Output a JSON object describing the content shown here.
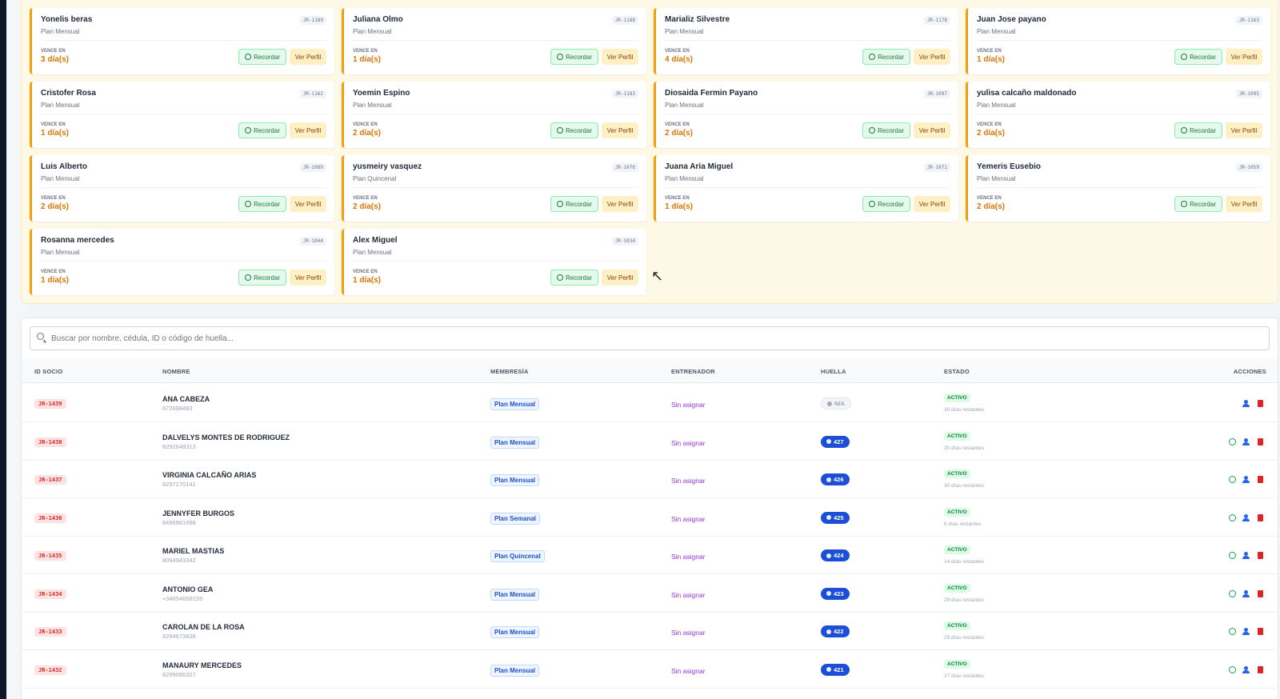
{
  "alerts": {
    "vence_label": "VENCE EN",
    "recordar_label": "Recordar",
    "perfil_label": "Ver Perfil",
    "cards": [
      {
        "name": "Yonelis beras",
        "plan": "Plan Mensual",
        "code": "JR-1189",
        "days": "3 día(s)"
      },
      {
        "name": "Juliana Olmo",
        "plan": "Plan Mensual",
        "code": "JR-1188",
        "days": "1 día(s)"
      },
      {
        "name": "Marializ Silvestre",
        "plan": "Plan Mensual",
        "code": "JR-1178",
        "days": "4 día(s)"
      },
      {
        "name": "Juan Jose payano",
        "plan": "Plan Mensual",
        "code": "JR-1163",
        "days": "1 día(s)"
      },
      {
        "name": "Cristofer Rosa",
        "plan": "Plan Mensual",
        "code": "JR-1162",
        "days": "1 día(s)"
      },
      {
        "name": "Yoemin Espino",
        "plan": "Plan Mensual",
        "code": "JR-1183",
        "days": "2 día(s)"
      },
      {
        "name": "Diosaida Fermin Payano",
        "plan": "Plan Mensual",
        "code": "JR-1097",
        "days": "2 día(s)"
      },
      {
        "name": "yulisa calcaño maldonado",
        "plan": "Plan Mensual",
        "code": "JR-1095",
        "days": "2 día(s)"
      },
      {
        "name": "Luis Alberto",
        "plan": "Plan Mensual",
        "code": "JR-1089",
        "days": "2 día(s)"
      },
      {
        "name": "yusmeiry vasquez",
        "plan": "Plan Quincenal",
        "code": "JR-1076",
        "days": "2 día(s)"
      },
      {
        "name": "Juana Aria Miguel",
        "plan": "Plan Mensual",
        "code": "JR-1071",
        "days": "1 día(s)"
      },
      {
        "name": "Yemeris Eusebio",
        "plan": "Plan Mensual",
        "code": "JR-1059",
        "days": "2 día(s)"
      },
      {
        "name": "Rosanna mercedes",
        "plan": "Plan Mensual",
        "code": "JR-1044",
        "days": "1 día(s)"
      },
      {
        "name": "Alex Miguel",
        "plan": "Plan Mensual",
        "code": "JR-1034",
        "days": "1 día(s)"
      }
    ]
  },
  "search": {
    "placeholder": "Buscar por nombre, cédula, ID o código de huella..."
  },
  "table": {
    "headers": {
      "id": "ID SOCIO",
      "nombre": "NOMBRE",
      "membresia": "MEMBRESÍA",
      "entrenador": "ENTRENADOR",
      "huella": "HUELLA",
      "estado": "ESTADO",
      "acciones": "ACCIONES"
    },
    "rows": [
      {
        "id": "JR-1439",
        "name": "ANA CABEZA",
        "phone": "672698483",
        "plan": "Plan Mensual",
        "trainer": "Sin asignar",
        "huella": "N/A",
        "status": "ACTIVO",
        "remaining": "30 días restantes"
      },
      {
        "id": "JR-1438",
        "name": "DALVELYS MONTES DE RODRIGUEZ",
        "phone": "8292648313",
        "plan": "Plan Mensual",
        "trainer": "Sin asignar",
        "huella": "427",
        "status": "ACTIVO",
        "remaining": "30 días restantes"
      },
      {
        "id": "JR-1437",
        "name": "VIRGINIA CALCAÑO ARIAS",
        "phone": "8297170141",
        "plan": "Plan Mensual",
        "trainer": "Sin asignar",
        "huella": "426",
        "status": "ACTIVO",
        "remaining": "30 días restantes"
      },
      {
        "id": "JR-1436",
        "name": "JENNYFER BURGOS",
        "phone": "8496961698",
        "plan": "Plan Semanal",
        "trainer": "Sin asignar",
        "huella": "425",
        "status": "ACTIVO",
        "remaining": "6 días restantes"
      },
      {
        "id": "JR-1435",
        "name": "MARIEL MASTIAS",
        "phone": "8094943342",
        "plan": "Plan Quincenal",
        "trainer": "Sin asignar",
        "huella": "424",
        "status": "ACTIVO",
        "remaining": "14 días restantes"
      },
      {
        "id": "JR-1434",
        "name": "ANTONIO GEA",
        "phone": "+34654658155",
        "plan": "Plan Mensual",
        "trainer": "Sin asignar",
        "huella": "423",
        "status": "ACTIVO",
        "remaining": "29 días restantes"
      },
      {
        "id": "JR-1433",
        "name": "CAROLAN DE LA ROSA",
        "phone": "8294673838",
        "plan": "Plan Mensual",
        "trainer": "Sin asignar",
        "huella": "422",
        "status": "ACTIVO",
        "remaining": "29 días restantes"
      },
      {
        "id": "JR-1432",
        "name": "MANAURY MERCEDES",
        "phone": "8299086327",
        "plan": "Plan Mensual",
        "trainer": "Sin asignar",
        "huella": "421",
        "status": "ACTIVO",
        "remaining": "27 días restantes"
      }
    ]
  }
}
